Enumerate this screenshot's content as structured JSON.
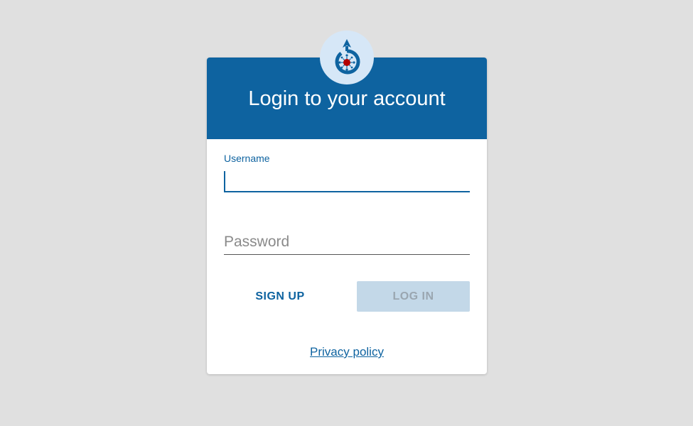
{
  "header": {
    "title": "Login to your account",
    "logo_icon": "wikimedia-commons-logo-icon"
  },
  "form": {
    "username_label": "Username",
    "username_value": "",
    "password_placeholder": "Password",
    "password_value": ""
  },
  "actions": {
    "signup_label": "SIGN UP",
    "login_label": "LOG IN"
  },
  "footer": {
    "privacy_label": "Privacy policy"
  },
  "colors": {
    "background": "#e0e0e0",
    "primary": "#0e63a0",
    "logo_bg": "#d6e7f7",
    "disabled_button_bg": "#c3d8e8",
    "disabled_button_text": "#9aa6b0",
    "logo_center": "#b30000"
  }
}
